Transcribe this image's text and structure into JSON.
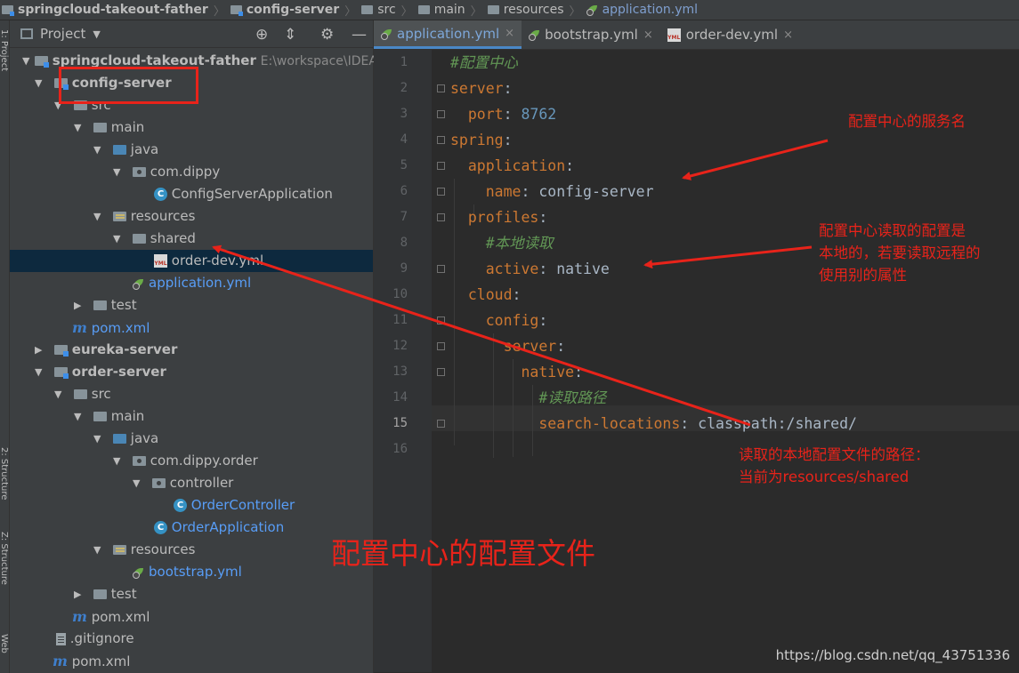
{
  "breadcrumb": [
    "springcloud-takeout-father",
    "config-server",
    "src",
    "main",
    "resources",
    "application.yml"
  ],
  "side_stripe": {
    "top": "1: Project",
    "mid": "2: Structure",
    "low": "Z: Structure",
    "bottom": "Web"
  },
  "project_panel": {
    "title": "Project",
    "tree": [
      {
        "label": "springcloud-takeout-father",
        "extra": "E:\\workspace\\IDEA\\s"
      },
      {
        "label": "config-server"
      },
      {
        "label": "src"
      },
      {
        "label": "main"
      },
      {
        "label": "java"
      },
      {
        "label": "com.dippy"
      },
      {
        "label": "ConfigServerApplication"
      },
      {
        "label": "resources"
      },
      {
        "label": "shared"
      },
      {
        "label": "order-dev.yml"
      },
      {
        "label": "application.yml"
      },
      {
        "label": "test"
      },
      {
        "label": "pom.xml"
      },
      {
        "label": "eureka-server"
      },
      {
        "label": "order-server"
      },
      {
        "label": "src"
      },
      {
        "label": "main"
      },
      {
        "label": "java"
      },
      {
        "label": "com.dippy.order"
      },
      {
        "label": "controller"
      },
      {
        "label": "OrderController"
      },
      {
        "label": "OrderApplication"
      },
      {
        "label": "resources"
      },
      {
        "label": "bootstrap.yml"
      },
      {
        "label": "test"
      },
      {
        "label": "pom.xml"
      },
      {
        "label": ".gitignore"
      },
      {
        "label": "pom.xml"
      }
    ]
  },
  "editor": {
    "tabs": [
      {
        "label": "application.yml",
        "close": "×"
      },
      {
        "label": "bootstrap.yml",
        "close": "×"
      },
      {
        "label": "order-dev.yml",
        "close": "×"
      }
    ],
    "line_numbers": [
      "1",
      "2",
      "3",
      "4",
      "5",
      "6",
      "7",
      "8",
      "9",
      "10",
      "11",
      "12",
      "13",
      "14",
      "15",
      "16"
    ],
    "code": {
      "l1": "#配置中心",
      "l2_key": "server",
      "l2_colon": ":",
      "l3_key": "port",
      "l3_colon": ": ",
      "l3_val": "8762",
      "l4_key": "spring",
      "l4_colon": ":",
      "l5_key": "application",
      "l5_colon": ":",
      "l6_key": "name",
      "l6_colon": ": ",
      "l6_val": "config-server",
      "l7_key": "profiles",
      "l7_colon": ":",
      "l8": "#本地读取",
      "l9_key": "active",
      "l9_colon": ": ",
      "l9_val": "native",
      "l10_key": "cloud",
      "l10_colon": ":",
      "l11_key": "config",
      "l11_colon": ":",
      "l12_key": "server",
      "l12_colon": ":",
      "l13_key": "native",
      "l13_colon": ":",
      "l14": "#读取路径",
      "l15_key": "search-locations",
      "l15_colon": ": ",
      "l15_val": "classpath:/shared/"
    }
  },
  "annotations": {
    "service_name": "配置中心的服务名",
    "local_config_1": "配置中心读取的配置是",
    "local_config_2": "本地的，若要读取远程的",
    "local_config_3": "使用别的属性",
    "path_1": "读取的本地配置文件的路径：",
    "path_2": "当前为resources/shared",
    "big": "配置中心的配置文件"
  },
  "watermark": "https://blog.csdn.net/qq_43751336",
  "colors": {
    "annotation": "#e8231a",
    "yaml_key": "#cc7832",
    "comment": "#629755",
    "number": "#6897bb",
    "selection": "#0d293e"
  }
}
